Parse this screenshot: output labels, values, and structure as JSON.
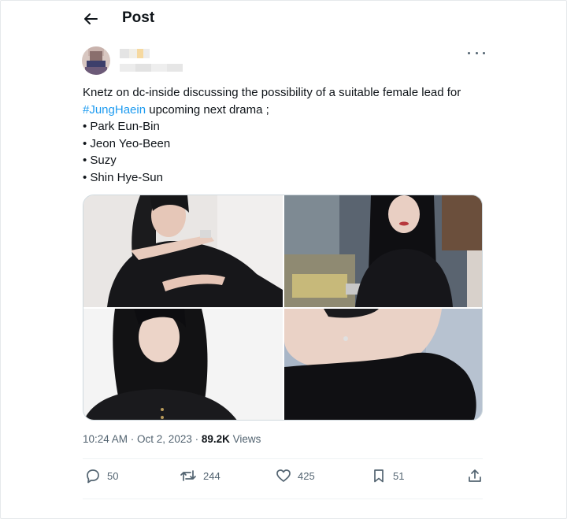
{
  "header": {
    "title": "Post",
    "back_icon": "arrow-left-icon"
  },
  "author": {
    "name": "",
    "handle": "",
    "avatar_colors": [
      "#c9b3ad",
      "#8a6f6d",
      "#3d3f6b",
      "#6c5a78",
      "#d8c7c1"
    ]
  },
  "post": {
    "lines": [
      {
        "text": "Knetz on dc-inside discussing the possibility of a suitable female lead for"
      },
      {
        "hashtag": "#JungHaein",
        "text": " upcoming next drama ;"
      },
      {
        "text": "• Park Eun-Bin"
      },
      {
        "text": "• Jeon Yeo-Been"
      },
      {
        "text": "• Suzy"
      },
      {
        "text": "• Shin Hye-Sun"
      }
    ]
  },
  "meta": {
    "time": "10:24 AM",
    "separator": " · ",
    "date": "Oct 2, 2023",
    "sep2": " · ",
    "views_count": "89.2K",
    "views_label": " Views"
  },
  "actions": {
    "replies": "50",
    "reposts": "244",
    "likes": "425",
    "bookmarks": "51"
  },
  "colors": {
    "accent": "#1d9bf0",
    "text": "#0f1419",
    "muted": "#536471",
    "border": "#cfd9de"
  }
}
